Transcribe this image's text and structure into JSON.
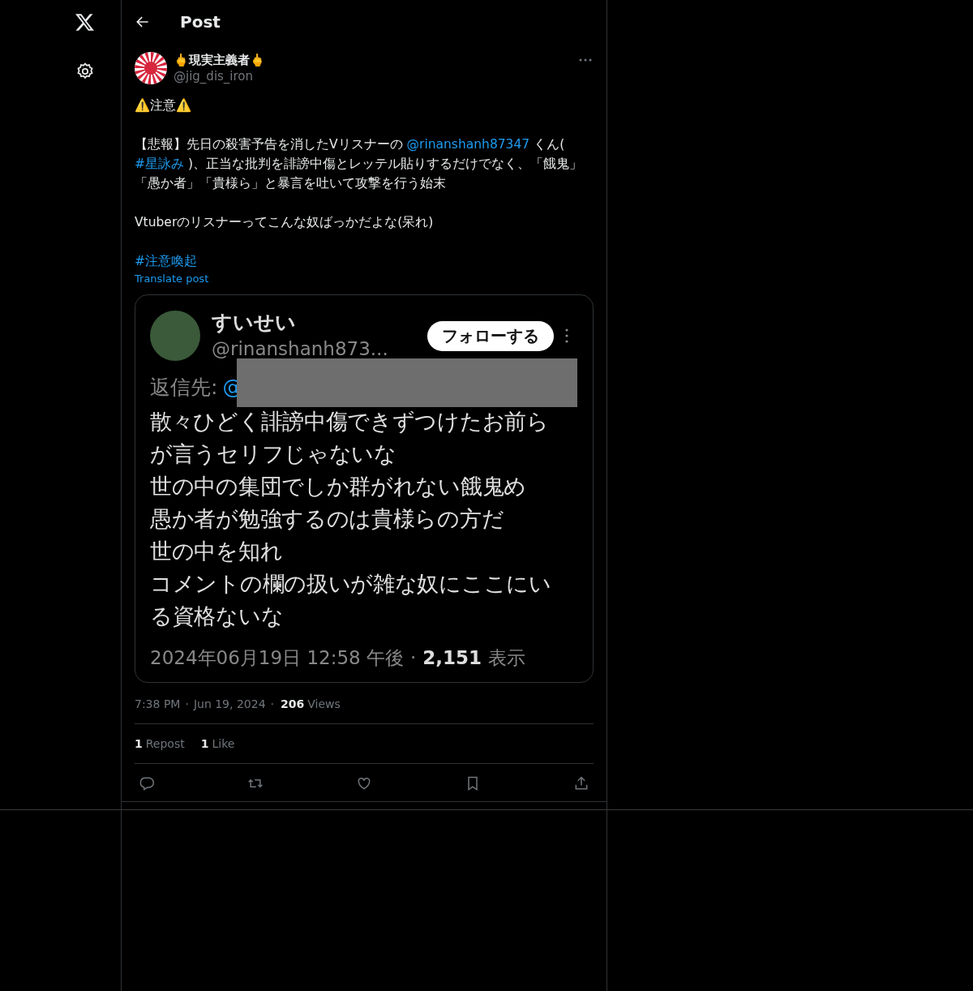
{
  "header": {
    "title": "Post"
  },
  "post": {
    "author": {
      "name": "🖕現実主義者🖕",
      "handle": "@jig_dis_iron"
    },
    "paragraphs": [
      [
        {
          "kind": "text",
          "text": "⚠️注意⚠️"
        }
      ],
      [
        {
          "kind": "text",
          "text": "【悲報】先日の殺害予告を消したVリスナーの "
        },
        {
          "kind": "mention",
          "text": "@rinanshanh87347"
        },
        {
          "kind": "text",
          "text": " くん( "
        },
        {
          "kind": "hashtag",
          "text": "#星詠み"
        },
        {
          "kind": "text",
          "text": " )、正当な批判を誹謗中傷とレッテル貼りするだけでなく、「餓鬼」「愚か者」「貴様ら」と暴言を吐いて攻撃を行う始末"
        }
      ],
      [
        {
          "kind": "text",
          "text": "Vtuberのリスナーってこんな奴ばっかだよな(呆れ)"
        }
      ],
      [
        {
          "kind": "hashtag",
          "text": "#注意喚起"
        }
      ]
    ],
    "translate": "Translate post",
    "embed": {
      "name": "すいせい",
      "handle": "@rinanshanh873...",
      "follow": "フォローする",
      "reply_prefix": "返信先:",
      "reply_mention": "@",
      "lines": [
        "散々ひどく誹謗中傷できずつけたお前ら",
        "が言うセリフじゃないな",
        "世の中の集団でしか群がれない餓鬼め",
        "愚か者が勉強するのは貴様らの方だ",
        "世の中を知れ",
        "コメントの欄の扱いが雑な奴にここにい",
        "る資格ないな"
      ],
      "date": "2024年06月19日 12:58 午後",
      "separator": "·",
      "views_count": "2,151",
      "views_label": "表示"
    },
    "time": "7:38 PM",
    "date": "Jun 19, 2024",
    "separator": "·",
    "views_count": "206",
    "views_label": "Views",
    "stats": [
      {
        "count": "1",
        "label": "Repost"
      },
      {
        "count": "1",
        "label": "Like"
      }
    ]
  }
}
